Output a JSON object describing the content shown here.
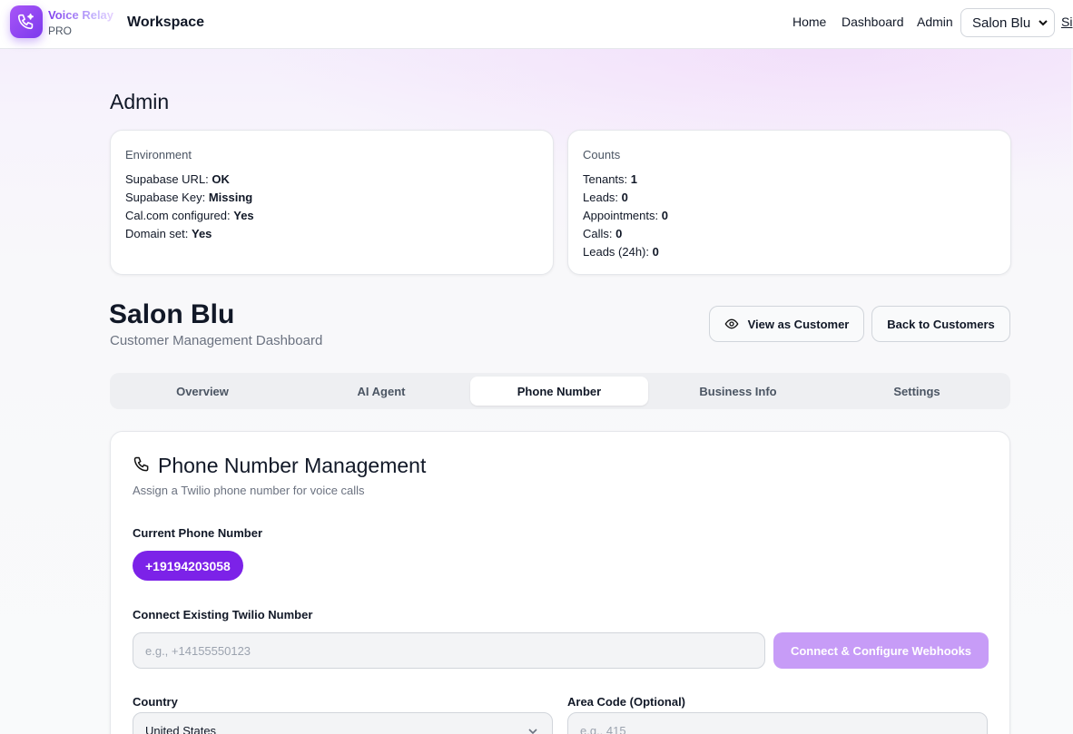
{
  "header": {
    "brand_name": "Voice Relay",
    "brand_tier": "PRO",
    "workspace": "Workspace",
    "nav": [
      "Home",
      "Dashboard",
      "Admin"
    ],
    "tenant_selected": "Salon Blu",
    "signout_label": "Si"
  },
  "admin": {
    "title": "Admin",
    "environment": {
      "label": "Environment",
      "items": [
        {
          "key": "Supabase URL:",
          "value": "OK"
        },
        {
          "key": "Supabase Key:",
          "value": "Missing"
        },
        {
          "key": "Cal.com configured:",
          "value": "Yes"
        },
        {
          "key": "Domain set:",
          "value": "Yes"
        }
      ]
    },
    "counts": {
      "label": "Counts",
      "items": [
        {
          "key": "Tenants:",
          "value": "1"
        },
        {
          "key": "Leads:",
          "value": "0"
        },
        {
          "key": "Appointments:",
          "value": "0"
        },
        {
          "key": "Calls:",
          "value": "0"
        },
        {
          "key": "Leads (24h):",
          "value": "0"
        }
      ]
    }
  },
  "customer": {
    "name": "Salon Blu",
    "subtitle": "Customer Management Dashboard",
    "view_as_customer": "View as Customer",
    "back_to_customers": "Back to Customers"
  },
  "tabs": {
    "items": [
      "Overview",
      "AI Agent",
      "Phone Number",
      "Business Info",
      "Settings"
    ],
    "active": "Phone Number"
  },
  "phone": {
    "title": "Phone Number Management",
    "description": "Assign a Twilio phone number for voice calls",
    "current_label": "Current Phone Number",
    "current_number": "+19194203058",
    "connect_label": "Connect Existing Twilio Number",
    "connect_placeholder": "e.g., +14155550123",
    "connect_button": "Connect & Configure Webhooks",
    "country_label": "Country",
    "country_value": "United States",
    "area_code_label": "Area Code (Optional)",
    "area_code_placeholder": "e.g., 415"
  },
  "colors": {
    "primary": "#7c22e8",
    "primary_disabled": "#c79cf7"
  }
}
